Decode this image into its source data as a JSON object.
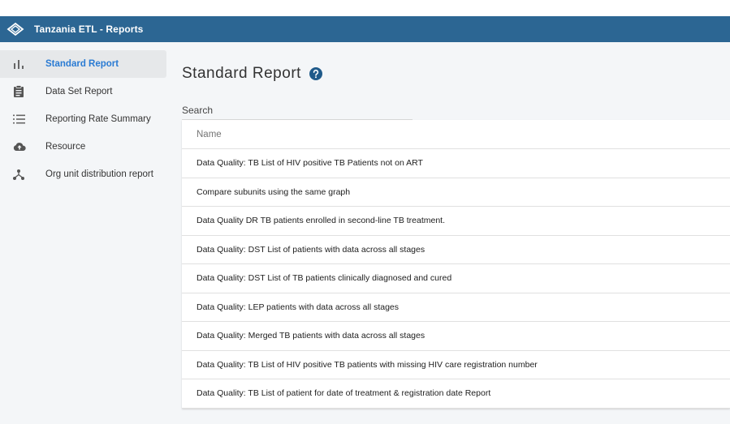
{
  "header": {
    "title": "Tanzania ETL - Reports"
  },
  "sidebar": {
    "items": [
      {
        "label": "Standard Report"
      },
      {
        "label": "Data Set Report"
      },
      {
        "label": "Reporting Rate Summary"
      },
      {
        "label": "Resource"
      },
      {
        "label": "Org unit distribution report"
      }
    ]
  },
  "main": {
    "title": "Standard Report",
    "search": {
      "placeholder": "Search",
      "value": ""
    },
    "table": {
      "header": "Name",
      "rows": [
        "Data Quality: TB List of HIV positive TB Patients not on ART",
        "Compare subunits using the same graph",
        "Data Quality DR TB patients enrolled in second-line TB treatment.",
        "Data Quality: DST List of patients with data across all stages",
        "Data Quality: DST List of TB patients clinically diagnosed and cured",
        "Data Quality: LEP patients with data across all stages",
        "Data Quality: Merged TB patients with data across all stages",
        "Data Quality: TB List of HIV positive TB patients with missing HIV care registration number",
        "Data Quality: TB List of patient for date of treatment & registration date Report"
      ]
    }
  },
  "colors": {
    "header_bg": "#2c6693",
    "active_text": "#2a7bd3",
    "help_icon": "#1f5a8a"
  }
}
